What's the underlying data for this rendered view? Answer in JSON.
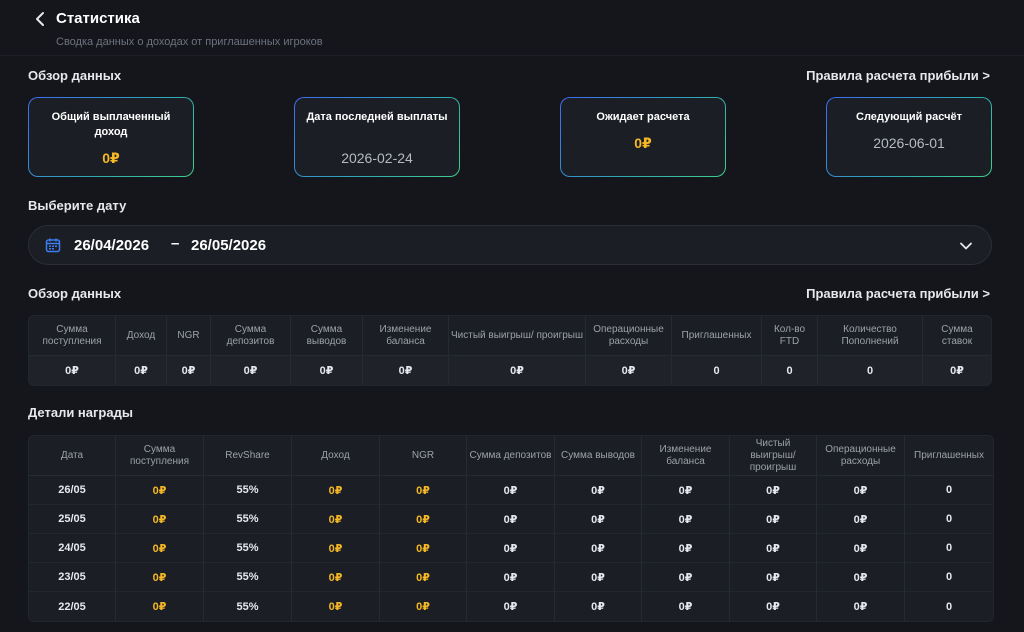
{
  "header": {
    "title": "Статистика",
    "subtitle": "Сводка данных о доходах от приглашенных игроков"
  },
  "overview": {
    "title": "Обзор данных",
    "rules_link": "Правила расчета прибыли >",
    "cards": [
      {
        "label": "Общий выплаченный доход",
        "value": "0₽"
      },
      {
        "label": "Дата последней выплаты",
        "value": "2026-02-24"
      },
      {
        "label": "Ожидает расчета",
        "value": "0₽"
      },
      {
        "label": "Следующий расчёт",
        "value": "2026-06-01"
      }
    ]
  },
  "date_picker": {
    "title": "Выберите дату",
    "from": "26/04/2026",
    "separator": "–",
    "to": "26/05/2026"
  },
  "summary": {
    "title": "Обзор данных",
    "rules_link": "Правила расчета прибыли >",
    "columns": [
      "Сумма поступления",
      "Доход",
      "NGR",
      "Сумма депозитов",
      "Сумма выводов",
      "Изменение баланса",
      "Чистый выигрыш/ проигрыш",
      "Операционные расходы",
      "Приглашенных",
      "Кол-во FTD",
      "Количество Пополнений",
      "Сумма ставок"
    ],
    "values": [
      "0₽",
      "0₽",
      "0₽",
      "0₽",
      "0₽",
      "0₽",
      "0₽",
      "0₽",
      "0",
      "0",
      "0",
      "0₽"
    ]
  },
  "rewards": {
    "title": "Детали награды",
    "columns": [
      "Дата",
      "Сумма поступления",
      "RevShare",
      "Доход",
      "NGR",
      "Сумма депозитов",
      "Сумма выводов",
      "Изменение баланса",
      "Чистый выигрыш/ проигрыш",
      "Операционные расходы",
      "Приглашенных"
    ],
    "rows": [
      [
        "26/05",
        "0₽",
        "55%",
        "0₽",
        "0₽",
        "0₽",
        "0₽",
        "0₽",
        "0₽",
        "0₽",
        "0"
      ],
      [
        "25/05",
        "0₽",
        "55%",
        "0₽",
        "0₽",
        "0₽",
        "0₽",
        "0₽",
        "0₽",
        "0₽",
        "0"
      ],
      [
        "24/05",
        "0₽",
        "55%",
        "0₽",
        "0₽",
        "0₽",
        "0₽",
        "0₽",
        "0₽",
        "0₽",
        "0"
      ],
      [
        "23/05",
        "0₽",
        "55%",
        "0₽",
        "0₽",
        "0₽",
        "0₽",
        "0₽",
        "0₽",
        "0₽",
        "0"
      ],
      [
        "22/05",
        "0₽",
        "55%",
        "0₽",
        "0₽",
        "0₽",
        "0₽",
        "0₽",
        "0₽",
        "0₽",
        "0"
      ]
    ]
  },
  "colors": {
    "background": "#14161b",
    "card_bg": "#1b1e25",
    "accent_gold": "#f6b824",
    "accent_blue": "#3d6cf2",
    "accent_green": "#3fd08a"
  }
}
